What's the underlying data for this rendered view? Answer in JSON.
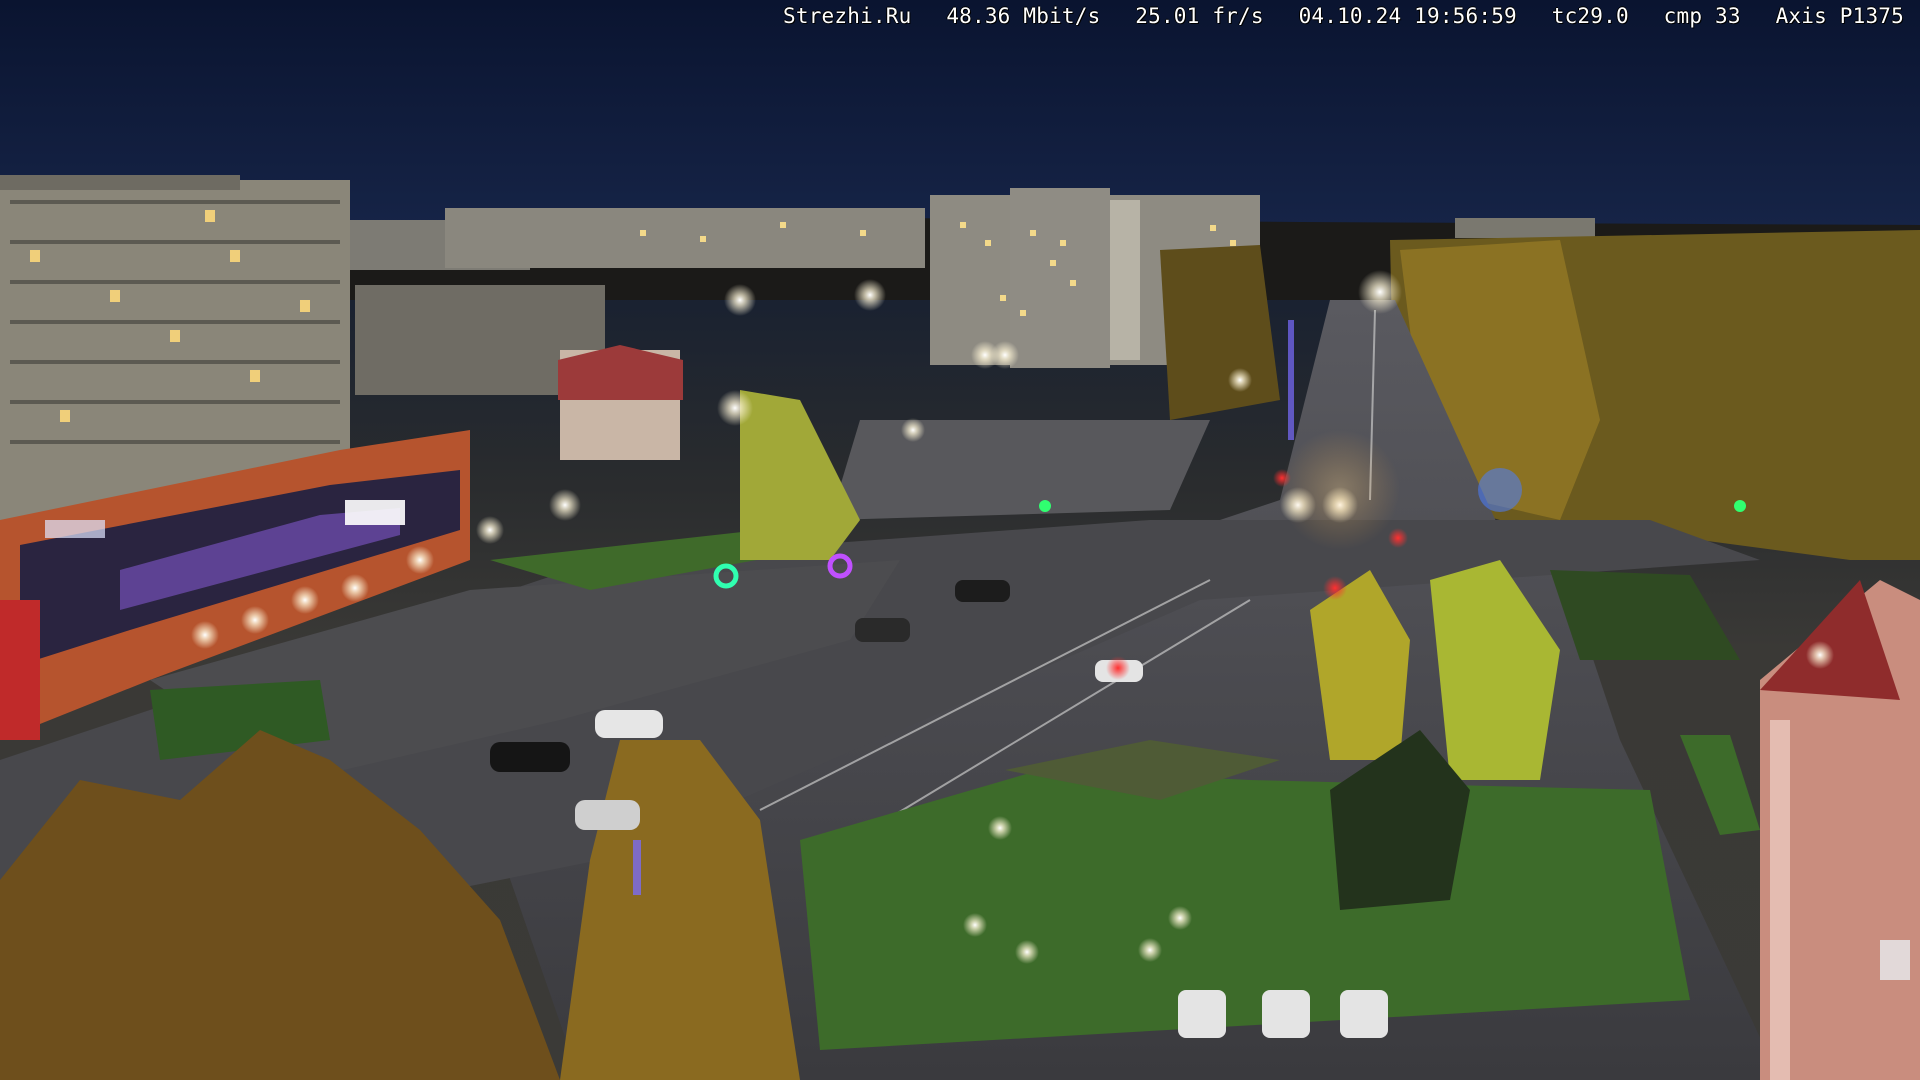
{
  "camera_overlay": {
    "site": "Strezhi.Ru",
    "bitrate": "48.36 Mbit/s",
    "framerate": "25.01 fr/s",
    "datetime": "04.10.24 19:56:59",
    "tc": "tc29.0",
    "cmp": "cmp 33",
    "camera_model": "Axis P1375"
  },
  "scene": {
    "description_tags": [
      "night",
      "city-street",
      "apartment-blocks",
      "street-lights",
      "autumn-trees",
      "parked-cars"
    ],
    "colors": {
      "sky": "#0c1631",
      "asphalt": "#3a3a3c",
      "grass": "#3e6b2e",
      "autumn_foliage": "#8a6a1c",
      "street_light": "#ffffff",
      "building_facade": "#8c8a80"
    }
  }
}
